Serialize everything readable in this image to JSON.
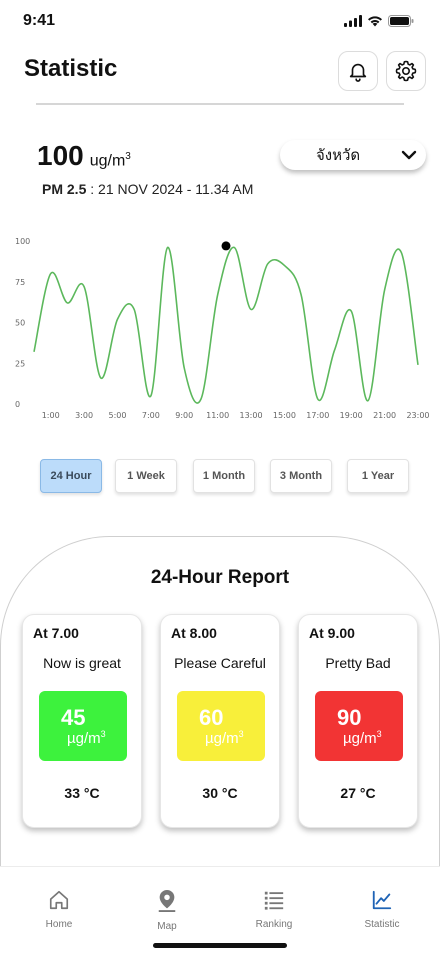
{
  "status_bar": {
    "time": "9:41"
  },
  "header": {
    "title": "Statistic",
    "bell_icon": "bell-icon",
    "settings_icon": "gear-icon"
  },
  "reading": {
    "value": "100",
    "unit": "ug/m",
    "unit_sup": "3",
    "pollutant": "PM 2.5",
    "timestamp": " : 21 NOV 2024 - 11.34 AM"
  },
  "province_select": {
    "value": "จังหวัด"
  },
  "chart_data": {
    "type": "line",
    "x": [
      "0:00",
      "1:00",
      "2:00",
      "3:00",
      "4:00",
      "5:00",
      "6:00",
      "7:00",
      "8:00",
      "9:00",
      "10:00",
      "11:00",
      "12:00",
      "13:00",
      "14:00",
      "15:00",
      "16:00",
      "17:00",
      "18:00",
      "19:00",
      "20:00",
      "21:00",
      "22:00",
      "23:00",
      "24:00"
    ],
    "tick_labels_x": [
      "1:00",
      "3:00",
      "5:00",
      "7:00",
      "9:00",
      "11:00",
      "13:00",
      "15:00",
      "17:00",
      "19:00",
      "21:00",
      "23:00"
    ],
    "y": [
      32,
      80,
      62,
      72,
      16,
      52,
      58,
      5,
      96,
      22,
      3,
      67,
      96,
      58,
      86,
      85,
      67,
      3,
      33,
      57,
      2,
      70,
      93,
      24
    ],
    "highlight": {
      "x": "11:30",
      "y": 97
    },
    "yticks": [
      0,
      25,
      50,
      75,
      100
    ],
    "ylim": [
      0,
      100
    ],
    "color": "#5cb85c",
    "grid": false
  },
  "ranges": [
    {
      "label": "24 Hour",
      "active": true
    },
    {
      "label": "1 Week",
      "active": false
    },
    {
      "label": "1 Month",
      "active": false
    },
    {
      "label": "3 Month",
      "active": false
    },
    {
      "label": "1 Year",
      "active": false
    }
  ],
  "report": {
    "title": "24-Hour Report",
    "cards": [
      {
        "time": "At 7.00",
        "status": "Now is great",
        "value": "45",
        "unit": "µg/m",
        "unit_sup": "3",
        "temp": "33 °C",
        "color": "#3df23d"
      },
      {
        "time": "At 8.00",
        "status": "Please Careful",
        "value": "60",
        "unit": "µg/m",
        "unit_sup": "3",
        "temp": "30 °C",
        "color": "#f8ef3a"
      },
      {
        "time": "At 9.00",
        "status": "Pretty Bad",
        "value": "90",
        "unit": "µg/m",
        "unit_sup": "3",
        "temp": "27 °C",
        "color": "#f23434"
      }
    ]
  },
  "nav": {
    "items": [
      {
        "label": "Home",
        "icon": "home-icon"
      },
      {
        "label": "Map",
        "icon": "map-pin-icon"
      },
      {
        "label": "Ranking",
        "icon": "list-icon"
      },
      {
        "label": "Statistic",
        "icon": "chart-icon",
        "active": true
      }
    ],
    "active_color": "#1e63b5"
  }
}
